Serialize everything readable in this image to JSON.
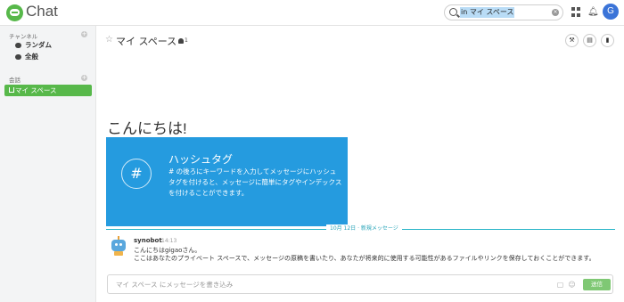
{
  "app": {
    "title": "Chat"
  },
  "header": {
    "search_value": "in マイ スペース",
    "avatar_initial": "G"
  },
  "sidebar": {
    "channels_title": "チャンネル",
    "channels": [
      {
        "label": "ランダム"
      },
      {
        "label": "全般"
      }
    ],
    "conversations_title": "会話",
    "active_conversation": "マイ スペース"
  },
  "main": {
    "space_title": "マイ スペース",
    "member_count": "1",
    "greeting": "こんにちは!",
    "promo": {
      "title": "ハッシュタグ",
      "body": "# の後ろにキーワードを入力してメッセージにハッシュタグを付けると、メッセージに簡単にタグやインデックスを付けることができます。"
    },
    "divider_label": "10月 12日 · 新規メッセージ",
    "message": {
      "sender": "synobot",
      "time": "14:13",
      "line1": "こんにちはgigaoさん。",
      "line2": "ここはあなたのプライベート スペースで、メッセージの原稿を書いたり、あなたが将来的に使用する可能性があるファイルやリンクを保存しておくことができます。"
    },
    "composer": {
      "placeholder": "マイ スペース にメッセージを書き込み",
      "send_label": "送信"
    }
  },
  "colors": {
    "brand_green": "#57b84a",
    "promo_blue": "#259bdf",
    "divider_teal": "#27b4c8",
    "avatar_blue": "#3b74d8"
  }
}
